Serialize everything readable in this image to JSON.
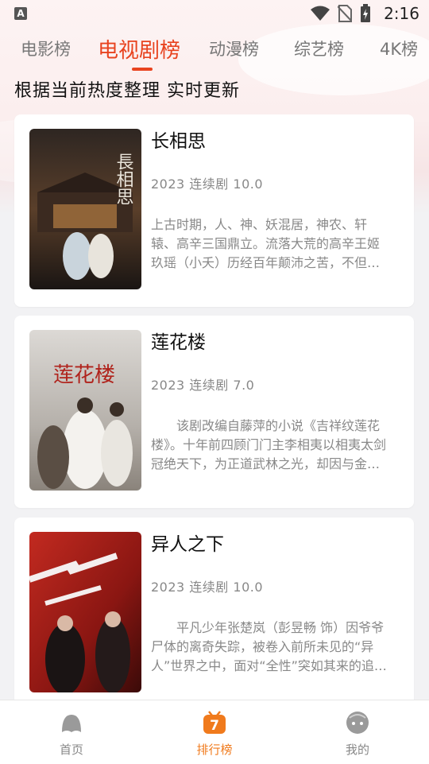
{
  "status_bar": {
    "app_badge": "A",
    "time": "2:16"
  },
  "tabs": [
    {
      "label": "电影榜",
      "active": false
    },
    {
      "label": "电视剧榜",
      "active": true
    },
    {
      "label": "动漫榜",
      "active": false
    },
    {
      "label": "综艺榜",
      "active": false
    },
    {
      "label": "4K榜",
      "active": false
    }
  ],
  "subtitle": "根据当前热度整理 实时更新",
  "items": [
    {
      "title": "长相思",
      "meta": "2023  连续剧  10.0",
      "desc": "上古时期，人、神、妖混居，神农、轩辕、高辛三国鼎立。流落大荒的高辛王姬玖瑶（小夭）历经百年颠沛之苦，不但失去了身份，也失去了容貌，在清水镇化名玟小六，过着平凡的日子。",
      "poster_text": "長相思",
      "poster_colors": [
        "#2a2320",
        "#6b4a2e",
        "#1c1714"
      ]
    },
    {
      "title": "莲花楼",
      "meta": "2023  连续剧  7.0",
      "desc": "　　该剧改编自藤萍的小说《吉祥纹莲花楼》。十年前四顾门门主李相夷以相夷太剑冠绝天下，为正道武林之光，却因与金鸳盟盟主笛飞声约战东海，两败俱伤。",
      "poster_text": "莲花楼",
      "poster_colors": [
        "#d9d6d2",
        "#a9a5a0",
        "#7d766f"
      ]
    },
    {
      "title": "异人之下",
      "meta": "2023  连续剧  10.0",
      "desc": "　　平凡少年张楚岚（彭昱畅 饰）因爷爷尸体的离奇失踪，被卷入前所未见的“异人”世界之中，面对“全性”突如其来的追杀、神秘少女冯宝宝（王影璐 饰）的出现。",
      "poster_text": "之下",
      "poster_colors": [
        "#b8231d",
        "#7a1210",
        "#1a1a1a"
      ]
    }
  ],
  "bottom_nav": [
    {
      "label": "首页",
      "icon": "home-ghost-icon",
      "active": false
    },
    {
      "label": "排行榜",
      "icon": "ranking-tv-icon",
      "active": true,
      "badge": "7"
    },
    {
      "label": "我的",
      "icon": "profile-ghost-icon",
      "active": false
    }
  ],
  "colors": {
    "accent": "#e8431f",
    "nav_active": "#f07a1c"
  }
}
